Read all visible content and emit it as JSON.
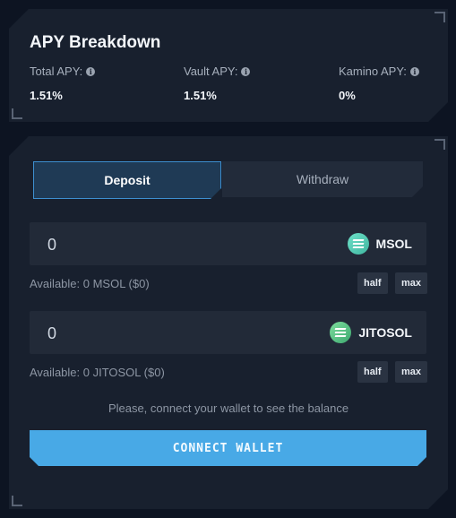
{
  "apy": {
    "title": "APY Breakdown",
    "total": {
      "label": "Total APY:",
      "value": "1.51%"
    },
    "vault": {
      "label": "Vault APY:",
      "value": "1.51%"
    },
    "kamino": {
      "label": "Kamino APY:",
      "value": "0%"
    }
  },
  "tabs": {
    "deposit": "Deposit",
    "withdraw": "Withdraw",
    "active": "deposit"
  },
  "inputs": [
    {
      "value": "0",
      "token": "MSOL",
      "icon": "msol-token-icon",
      "available": "Available: 0 MSOL ($0)",
      "half": "half",
      "max": "max"
    },
    {
      "value": "0",
      "token": "JITOSOL",
      "icon": "jitosol-token-icon",
      "available": "Available: 0 JITOSOL ($0)",
      "half": "half",
      "max": "max"
    }
  ],
  "note": "Please, connect your wallet to see the balance",
  "connect_label": "CONNECT WALLET",
  "colors": {
    "accent": "#48a9e6",
    "panel": "#18202e",
    "background": "#0d1422"
  }
}
